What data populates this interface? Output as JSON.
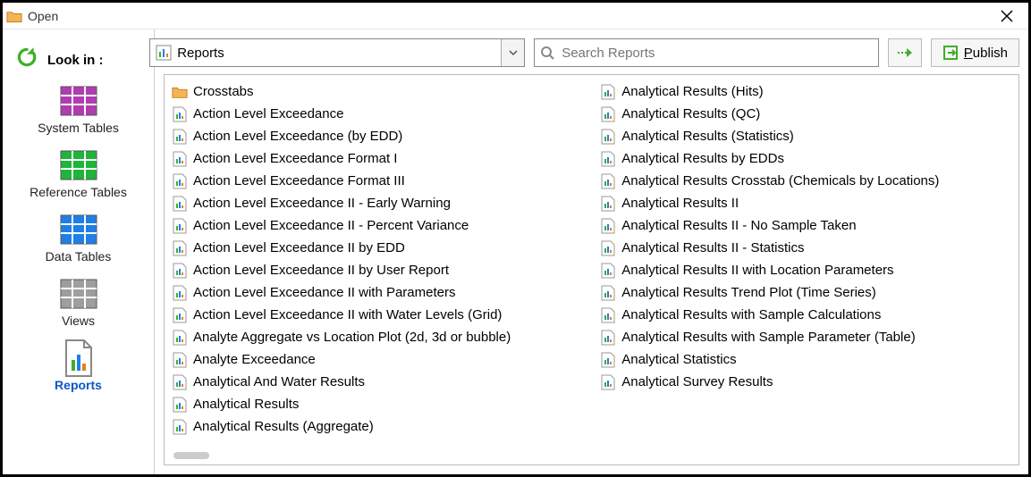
{
  "window": {
    "title": "Open"
  },
  "toolbar": {
    "lookin_label": "Look in :",
    "combo_value": "Reports",
    "search_placeholder": "Search Reports",
    "publish_label_prefix": "P",
    "publish_label_rest": "ublish"
  },
  "sidebar": {
    "categories": [
      {
        "label": "System Tables",
        "color": "#b03db0"
      },
      {
        "label": "Reference Tables",
        "color": "#1fb43a"
      },
      {
        "label": "Data Tables",
        "color": "#1f7fe6"
      },
      {
        "label": "Views",
        "color": "#9e9e9e"
      },
      {
        "label": "Reports",
        "color": "#0a58ca",
        "active": true,
        "type": "report"
      }
    ]
  },
  "items_col1": [
    {
      "label": "Crosstabs",
      "type": "folder"
    },
    {
      "label": "Action Level Exceedance",
      "type": "report"
    },
    {
      "label": "Action Level Exceedance (by EDD)",
      "type": "report"
    },
    {
      "label": "Action Level Exceedance Format I",
      "type": "report"
    },
    {
      "label": "Action Level Exceedance Format III",
      "type": "report"
    },
    {
      "label": "Action Level Exceedance II - Early Warning",
      "type": "report"
    },
    {
      "label": "Action Level Exceedance II - Percent Variance",
      "type": "report"
    },
    {
      "label": "Action Level Exceedance II by EDD",
      "type": "report"
    },
    {
      "label": "Action Level Exceedance II by User Report",
      "type": "report"
    },
    {
      "label": "Action Level Exceedance II with Parameters",
      "type": "report"
    },
    {
      "label": "Action Level Exceedance II with Water Levels (Grid)",
      "type": "report"
    },
    {
      "label": "Analyte Aggregate vs Location Plot (2d, 3d or bubble)",
      "type": "report"
    },
    {
      "label": "Analyte Exceedance",
      "type": "report"
    },
    {
      "label": "Analytical And Water Results",
      "type": "report"
    },
    {
      "label": "Analytical Results",
      "type": "report"
    }
  ],
  "items_col2": [
    {
      "label": "Analytical Results (Aggregate)",
      "type": "report"
    },
    {
      "label": "Analytical Results (Hits)",
      "type": "report"
    },
    {
      "label": "Analytical Results (QC)",
      "type": "report"
    },
    {
      "label": "Analytical Results (Statistics)",
      "type": "report"
    },
    {
      "label": "Analytical Results by EDDs",
      "type": "report"
    },
    {
      "label": "Analytical Results Crosstab (Chemicals by Locations)",
      "type": "report"
    },
    {
      "label": "Analytical Results II",
      "type": "report"
    },
    {
      "label": "Analytical Results II - No Sample Taken",
      "type": "report"
    },
    {
      "label": "Analytical Results II - Statistics",
      "type": "report"
    },
    {
      "label": "Analytical Results II with Location Parameters",
      "type": "report"
    },
    {
      "label": "Analytical Results Trend Plot (Time Series)",
      "type": "report"
    },
    {
      "label": "Analytical Results with Sample Calculations",
      "type": "report"
    },
    {
      "label": "Analytical Results with Sample Parameter (Table)",
      "type": "report"
    },
    {
      "label": "Analytical Statistics",
      "type": "report"
    },
    {
      "label": "Analytical Survey Results",
      "type": "report"
    }
  ]
}
